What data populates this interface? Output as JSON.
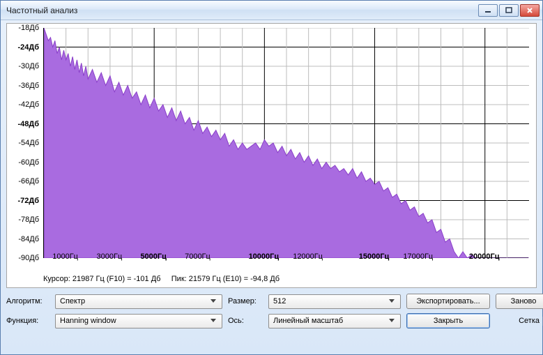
{
  "window": {
    "title": "Частотный анализ"
  },
  "status": {
    "cursor": "Курсор: 21987 Гц (F10) = -101 Дб",
    "peak": "Пик: 21579 Гц (E10) = -94,8 Дб"
  },
  "controls": {
    "algo_label": "Алгоритм:",
    "algo_value": "Спектр",
    "size_label": "Размер:",
    "size_value": "512",
    "export_label": "Экспортировать...",
    "redo_label": "Заново",
    "func_label": "Функция:",
    "func_value": "Hanning window",
    "axis_label": "Ось:",
    "axis_value": "Линейный масштаб",
    "close_label": "Закрыть",
    "grid_label": "Сетка",
    "grid_checked": true
  },
  "chart_data": {
    "type": "area",
    "xlabel": "",
    "ylabel": "",
    "xlim": [
      0,
      22000
    ],
    "ylim": [
      -90,
      -18
    ],
    "y_ticks": [
      {
        "v": -18,
        "label": "-18Дб",
        "bold": false
      },
      {
        "v": -24,
        "label": "-24Дб",
        "bold": true
      },
      {
        "v": -30,
        "label": "-30Дб",
        "bold": false
      },
      {
        "v": -36,
        "label": "-36Дб",
        "bold": false
      },
      {
        "v": -42,
        "label": "-42Дб",
        "bold": false
      },
      {
        "v": -48,
        "label": "-48Дб",
        "bold": true
      },
      {
        "v": -54,
        "label": "-54Дб",
        "bold": false
      },
      {
        "v": -60,
        "label": "-60Дб",
        "bold": false
      },
      {
        "v": -66,
        "label": "-66Дб",
        "bold": false
      },
      {
        "v": -72,
        "label": "-72Дб",
        "bold": true
      },
      {
        "v": -78,
        "label": "-78Дб",
        "bold": false
      },
      {
        "v": -84,
        "label": "-84Дб",
        "bold": false
      },
      {
        "v": -90,
        "label": "-90Дб",
        "bold": false
      }
    ],
    "x_ticks": [
      {
        "v": 1000,
        "label": "1000Гц",
        "bold": false
      },
      {
        "v": 3000,
        "label": "3000Гц",
        "bold": false
      },
      {
        "v": 5000,
        "label": "5000Гц",
        "bold": true
      },
      {
        "v": 7000,
        "label": "7000Гц",
        "bold": false
      },
      {
        "v": 10000,
        "label": "10000Гц",
        "bold": true
      },
      {
        "v": 12000,
        "label": "12000Гц",
        "bold": false
      },
      {
        "v": 15000,
        "label": "15000Гц",
        "bold": true
      },
      {
        "v": 17000,
        "label": "17000Гц",
        "bold": false
      },
      {
        "v": 20000,
        "label": "20000Гц",
        "bold": true
      }
    ],
    "series": [
      {
        "name": "spectrum",
        "color": "#8a3fc9",
        "fill": "#a96be0",
        "points": [
          [
            0,
            -18
          ],
          [
            100,
            -20
          ],
          [
            200,
            -22
          ],
          [
            300,
            -21
          ],
          [
            400,
            -24
          ],
          [
            500,
            -22
          ],
          [
            600,
            -26
          ],
          [
            700,
            -24
          ],
          [
            800,
            -28
          ],
          [
            900,
            -25
          ],
          [
            1000,
            -28
          ],
          [
            1100,
            -26
          ],
          [
            1200,
            -30
          ],
          [
            1300,
            -27
          ],
          [
            1400,
            -31
          ],
          [
            1500,
            -28
          ],
          [
            1600,
            -32
          ],
          [
            1700,
            -29
          ],
          [
            1800,
            -33
          ],
          [
            1900,
            -30
          ],
          [
            2000,
            -34
          ],
          [
            2200,
            -31
          ],
          [
            2400,
            -35
          ],
          [
            2600,
            -32
          ],
          [
            2800,
            -36
          ],
          [
            3000,
            -33
          ],
          [
            3200,
            -38
          ],
          [
            3400,
            -35
          ],
          [
            3600,
            -39
          ],
          [
            3800,
            -36
          ],
          [
            4000,
            -40
          ],
          [
            4200,
            -38
          ],
          [
            4400,
            -42
          ],
          [
            4600,
            -39
          ],
          [
            4800,
            -43
          ],
          [
            5000,
            -40
          ],
          [
            5200,
            -44
          ],
          [
            5400,
            -42
          ],
          [
            5600,
            -46
          ],
          [
            5800,
            -43
          ],
          [
            6000,
            -47
          ],
          [
            6200,
            -44
          ],
          [
            6400,
            -48
          ],
          [
            6600,
            -46
          ],
          [
            6800,
            -50
          ],
          [
            7000,
            -47
          ],
          [
            7200,
            -51
          ],
          [
            7400,
            -49
          ],
          [
            7600,
            -52
          ],
          [
            7800,
            -50
          ],
          [
            8000,
            -53
          ],
          [
            8200,
            -51
          ],
          [
            8400,
            -55
          ],
          [
            8600,
            -53
          ],
          [
            8800,
            -56
          ],
          [
            9000,
            -54
          ],
          [
            9200,
            -56
          ],
          [
            9400,
            -55
          ],
          [
            9600,
            -54
          ],
          [
            9800,
            -56
          ],
          [
            10000,
            -53
          ],
          [
            10200,
            -55
          ],
          [
            10400,
            -54
          ],
          [
            10600,
            -57
          ],
          [
            10800,
            -55
          ],
          [
            11000,
            -58
          ],
          [
            11200,
            -56
          ],
          [
            11400,
            -59
          ],
          [
            11600,
            -57
          ],
          [
            11800,
            -60
          ],
          [
            12000,
            -58
          ],
          [
            12200,
            -61
          ],
          [
            12400,
            -59
          ],
          [
            12600,
            -62
          ],
          [
            12800,
            -60
          ],
          [
            13000,
            -62
          ],
          [
            13200,
            -61
          ],
          [
            13400,
            -63
          ],
          [
            13600,
            -62
          ],
          [
            13800,
            -64
          ],
          [
            14000,
            -62
          ],
          [
            14200,
            -65
          ],
          [
            14400,
            -63
          ],
          [
            14600,
            -66
          ],
          [
            14800,
            -65
          ],
          [
            15000,
            -67
          ],
          [
            15200,
            -66
          ],
          [
            15400,
            -69
          ],
          [
            15600,
            -68
          ],
          [
            15800,
            -71
          ],
          [
            16000,
            -70
          ],
          [
            16200,
            -73
          ],
          [
            16400,
            -72
          ],
          [
            16600,
            -75
          ],
          [
            16800,
            -74
          ],
          [
            17000,
            -77
          ],
          [
            17200,
            -76
          ],
          [
            17400,
            -79
          ],
          [
            17600,
            -78
          ],
          [
            17800,
            -82
          ],
          [
            18000,
            -81
          ],
          [
            18200,
            -85
          ],
          [
            18400,
            -84
          ],
          [
            18600,
            -88
          ],
          [
            18800,
            -90
          ],
          [
            19000,
            -88
          ],
          [
            19200,
            -90
          ],
          [
            19400,
            -89
          ],
          [
            19600,
            -90
          ],
          [
            19800,
            -90
          ],
          [
            20000,
            -90
          ],
          [
            20500,
            -90
          ],
          [
            21000,
            -90
          ],
          [
            21500,
            -90
          ],
          [
            22000,
            -90
          ]
        ]
      }
    ]
  }
}
